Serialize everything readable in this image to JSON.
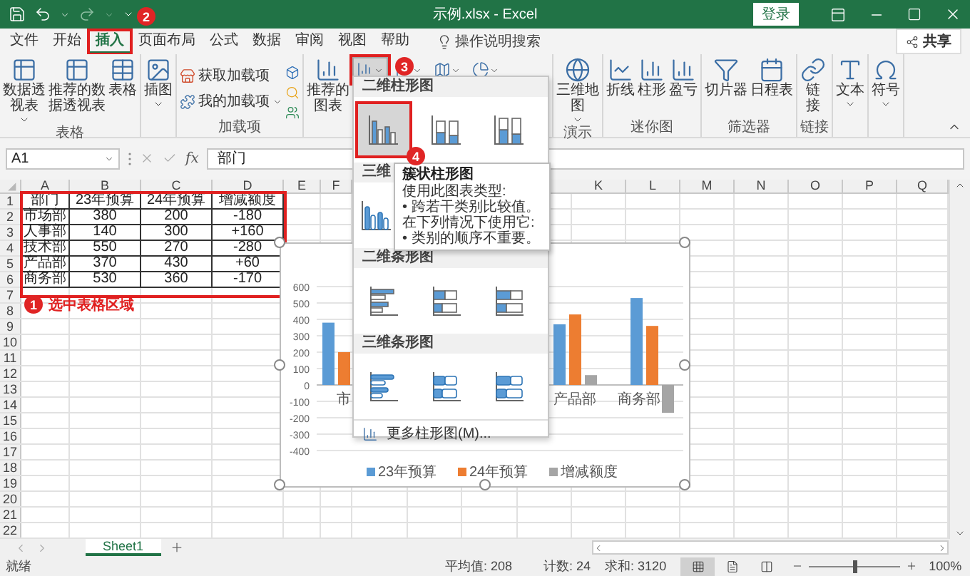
{
  "window": {
    "title": "示例.xlsx - Excel",
    "login": "登录"
  },
  "tabs": [
    {
      "label": "文件",
      "selected": false,
      "highlighted": false
    },
    {
      "label": "开始",
      "selected": false,
      "highlighted": false
    },
    {
      "label": "插入",
      "selected": true,
      "highlighted": true
    },
    {
      "label": "页面布局",
      "selected": false,
      "highlighted": false
    },
    {
      "label": "公式",
      "selected": false,
      "highlighted": false
    },
    {
      "label": "数据",
      "selected": false,
      "highlighted": false
    },
    {
      "label": "审阅",
      "selected": false,
      "highlighted": false
    },
    {
      "label": "视图",
      "selected": false,
      "highlighted": false
    },
    {
      "label": "帮助",
      "selected": false,
      "highlighted": false
    }
  ],
  "tell_me": {
    "placeholder": "操作说明搜索"
  },
  "share": "共享",
  "ribbon": {
    "groups": [
      {
        "label": "表格",
        "items": [
          {
            "kind": "large",
            "label": "数据透视表",
            "dropdown": true
          },
          {
            "kind": "large",
            "label": "推荐的数据透视表",
            "dropdown": false
          },
          {
            "kind": "large",
            "label": "表格",
            "dropdown": false
          }
        ]
      },
      {
        "items": [
          {
            "kind": "large",
            "label": "插图",
            "dropdown": true
          }
        ]
      },
      {
        "label": "加载项",
        "items": [
          {
            "kind": "small",
            "label": "获取加载项",
            "dropdown": false
          },
          {
            "kind": "small",
            "label": "我的加载项",
            "dropdown": true
          },
          {
            "kind": "apps"
          }
        ]
      },
      {
        "items": [
          {
            "kind": "large",
            "label": "推荐的图表",
            "dropdown": false
          },
          {
            "kind": "chart-buttons",
            "buttons": [
              {
                "selected": true,
                "highlighted": true
              },
              {
                "selected": false,
                "highlighted": false
              },
              {
                "selected": false,
                "highlighted": false
              },
              {
                "selected": false,
                "highlighted": false
              }
            ]
          }
        ]
      },
      {
        "label": "演示",
        "items": [
          {
            "kind": "large",
            "label": "三维地图",
            "dropdown": true
          }
        ]
      },
      {
        "label": "迷你图",
        "items": [
          {
            "kind": "large",
            "label": "折线",
            "dropdown": false
          },
          {
            "kind": "large",
            "label": "柱形",
            "dropdown": false
          },
          {
            "kind": "large",
            "label": "盈亏",
            "dropdown": false
          }
        ]
      },
      {
        "label": "筛选器",
        "items": [
          {
            "kind": "large",
            "label": "切片器",
            "dropdown": false
          },
          {
            "kind": "large",
            "label": "日程表",
            "dropdown": false
          }
        ]
      },
      {
        "label": "链接",
        "items": [
          {
            "kind": "large",
            "label": "链接",
            "dropdown": false
          }
        ]
      },
      {
        "items": [
          {
            "kind": "large",
            "label": "文本",
            "dropdown": true
          }
        ]
      },
      {
        "items": [
          {
            "kind": "large",
            "label": "符号",
            "dropdown": true
          }
        ]
      }
    ]
  },
  "formula_bar": {
    "name_box": "A1",
    "function_label": "fx",
    "value": "部门"
  },
  "sheet": {
    "columns": [
      "A",
      "B",
      "C",
      "D",
      "E",
      "F",
      "K",
      "L",
      "M",
      "N",
      "O",
      "P",
      "Q"
    ],
    "row_numbers": [
      "1",
      "2",
      "3",
      "4",
      "5",
      "6",
      "7",
      "8",
      "9",
      "10",
      "11",
      "12",
      "13",
      "14",
      "15",
      "16",
      "17",
      "18",
      "19",
      "20",
      "21",
      "22"
    ],
    "highlighted": true,
    "cells": [
      [
        "部门",
        "23年预算",
        "24年预算",
        "增减额度"
      ],
      [
        "市场部",
        "380",
        "200",
        "-180"
      ],
      [
        "人事部",
        "140",
        "300",
        "+160"
      ],
      [
        "技术部",
        "550",
        "270",
        "-280"
      ],
      [
        "产品部",
        "370",
        "430",
        "+60"
      ],
      [
        "商务部",
        "530",
        "360",
        "-170"
      ]
    ]
  },
  "chart": {
    "chart_data": {
      "type": "bar",
      "categories": [
        "市",
        null,
        null,
        "产品部",
        "商务部"
      ],
      "series": [
        {
          "name": "23年预算",
          "color": "#5b9bd5",
          "values": [
            380,
            null,
            null,
            370,
            530
          ]
        },
        {
          "name": "24年预算",
          "color": "#ed7d31",
          "values": [
            200,
            null,
            null,
            430,
            360
          ]
        },
        {
          "name": "增减额度",
          "color": "#a5a5a5",
          "values": [
            null,
            null,
            null,
            60,
            -170
          ]
        }
      ],
      "ylim": [
        -400,
        600
      ],
      "yticks": [
        600,
        500,
        400,
        300,
        200,
        100,
        0,
        -100,
        -200,
        -300,
        -400
      ],
      "grid": true,
      "legend": true
    }
  },
  "chart_menu": {
    "sections": [
      {
        "title": "二维柱形图",
        "kind": "column",
        "options": [
          {
            "selected": true,
            "highlighted": true
          },
          {
            "selected": false,
            "highlighted": false
          },
          {
            "selected": false,
            "highlighted": false
          }
        ]
      },
      {
        "title": "三维",
        "kind": "column3d",
        "options": [
          {
            "selected": false
          }
        ]
      },
      {
        "title": "二维条形图",
        "kind": "bar",
        "options": [
          {
            "selected": false
          },
          {
            "selected": false
          },
          {
            "selected": false
          }
        ]
      },
      {
        "title": "三维条形图",
        "kind": "bar3d",
        "options": [
          {
            "selected": false
          },
          {
            "selected": false
          },
          {
            "selected": false
          }
        ]
      }
    ],
    "more": "更多柱形图(M)..."
  },
  "tooltip": {
    "title": "簇状柱形图",
    "lines": [
      "使用此图表类型:",
      "• 跨若干类别比较值。",
      "在下列情况下使用它:",
      "• 类别的顺序不重要。"
    ]
  },
  "annotations": [
    {
      "number": "1",
      "label": "选中表格区域"
    },
    {
      "number": "2"
    },
    {
      "number": "3"
    },
    {
      "number": "4"
    }
  ],
  "sheet_tabs": [
    {
      "label": "Sheet1",
      "selected": true
    }
  ],
  "status": {
    "text": "就绪",
    "average": "平均值: 208",
    "count": "计数: 24",
    "sum": "求和: 3120",
    "views": [
      {
        "selected": true
      },
      {
        "selected": false
      },
      {
        "selected": false
      }
    ],
    "zoom": {
      "level": 0.5,
      "reading": "100%"
    }
  }
}
